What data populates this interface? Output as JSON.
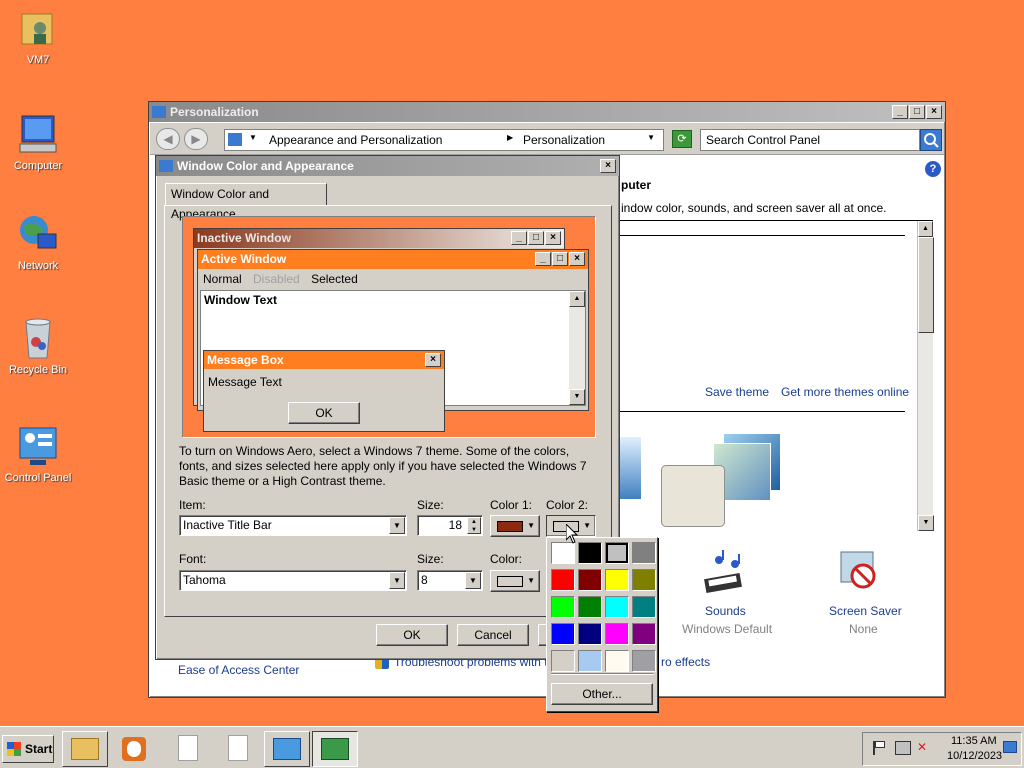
{
  "desktop": {
    "icons": [
      {
        "label": "VM7"
      },
      {
        "label": "Computer"
      },
      {
        "label": "Network"
      },
      {
        "label": "Recycle Bin"
      },
      {
        "label": "Control Panel"
      }
    ]
  },
  "personalization": {
    "title": "Personalization",
    "breadcrumb": [
      "Appearance and Personalization",
      "Personalization"
    ],
    "search_placeholder": "Search Control Panel",
    "heading_fragment": "puter",
    "desc_fragment": "indow color, sounds, and screen saver all at once.",
    "save_theme": "Save theme",
    "get_more_themes": "Get more themes online",
    "sounds_label": "Sounds",
    "sounds_value": "Windows Default",
    "screensaver_label": "Screen Saver",
    "screensaver_value": "None",
    "ease_of_access": "Ease of Access Center",
    "troubleshoot": "Troubleshoot problems with tra",
    "aero_fragment": "ro effects"
  },
  "dialog": {
    "title": "Window Color and Appearance",
    "tab": "Window Color and Appearance",
    "preview": {
      "inactive_title": "Inactive Window",
      "active_title": "Active Window",
      "menu_normal": "Normal",
      "menu_disabled": "Disabled",
      "menu_selected": "Selected",
      "window_text": "Window Text",
      "msgbox_title": "Message Box",
      "msgbox_text": "Message Text",
      "msgbox_ok": "OK"
    },
    "info_text": "To turn on Windows Aero, select a Windows 7 theme.  Some of the colors, fonts, and sizes selected here apply only if you have selected the Windows 7 Basic theme or a High Contrast theme.",
    "item_label": "Item:",
    "item_value": "Inactive Title Bar",
    "size_label": "Size:",
    "size_value": "18",
    "color1_label": "Color 1:",
    "color2_label": "Color 2:",
    "font_label": "Font:",
    "font_value": "Tahoma",
    "font_size_label": "Size:",
    "font_size_value": "8",
    "font_color_label": "Color:",
    "ok": "OK",
    "cancel": "Cancel"
  },
  "palette": {
    "colors": [
      "#FFFFFF",
      "#000000",
      "#C0C0C0",
      "#808080",
      "#FF0000",
      "#800000",
      "#FFFF00",
      "#808000",
      "#00FF00",
      "#008000",
      "#00FFFF",
      "#008080",
      "#0000FF",
      "#000080",
      "#FF00FF",
      "#800080",
      "#D4D0C8",
      "#A6CAF0",
      "#FFFBF0",
      "#A0A0A4"
    ],
    "selected_index": 2,
    "other": "Other..."
  },
  "taskbar": {
    "start": "Start",
    "time": "11:35 AM",
    "date": "10/12/2023"
  },
  "colors": {
    "desktop": "#FF7F40",
    "active_title": "#FF7F20",
    "inactive_title_left": "#8B3A1E",
    "color1_swatch": "#8B2A10"
  }
}
